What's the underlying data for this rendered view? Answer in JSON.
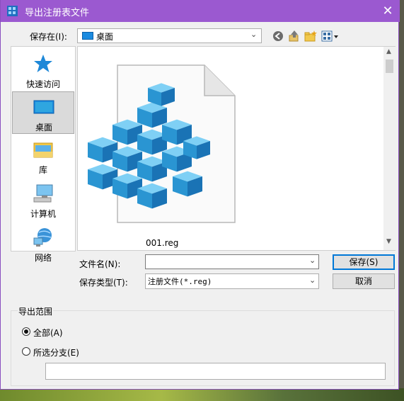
{
  "window": {
    "title": "导出注册表文件"
  },
  "toolbar": {
    "save_in_label": "保存在(I):",
    "location": "桌面",
    "icons": [
      "back-icon",
      "up-folder-icon",
      "new-folder-icon",
      "view-menu-icon"
    ]
  },
  "places": [
    {
      "label": "快速访问",
      "icon": "star-icon"
    },
    {
      "label": "桌面",
      "icon": "desktop-icon",
      "selected": true
    },
    {
      "label": "库",
      "icon": "library-icon"
    },
    {
      "label": "计算机",
      "icon": "computer-icon"
    },
    {
      "label": "网络",
      "icon": "network-icon"
    }
  ],
  "files": [
    {
      "name": "001.reg",
      "icon": "registry-file-icon"
    }
  ],
  "form": {
    "filename_label": "文件名(N):",
    "filename_value": "",
    "filetype_label": "保存类型(T):",
    "filetype_value": "注册文件(*.reg)",
    "save_button": "保存(S)",
    "cancel_button": "取消"
  },
  "export_range": {
    "legend": "导出范围",
    "all_label": "全部(A)",
    "branch_label": "所选分支(E)",
    "selected": "all",
    "branch_value": ""
  },
  "colors": {
    "titlebar": "#9b59d0",
    "accent": "#0078d7",
    "cube": "#2fa6e0"
  }
}
